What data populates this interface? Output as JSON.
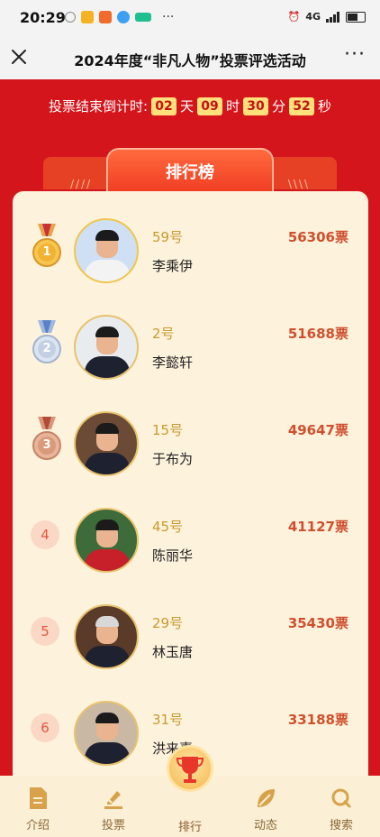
{
  "status_bar": {
    "time": "20:29",
    "network": "4G",
    "more": "···"
  },
  "nav": {
    "title": "2024年度“非凡人物”投票评选活动",
    "more": "···"
  },
  "countdown": {
    "label": "投票结束倒计时:",
    "days": "02",
    "days_unit": "天",
    "hours": "09",
    "hours_unit": "时",
    "minutes": "30",
    "minutes_unit": "分",
    "seconds": "52",
    "seconds_unit": "秒"
  },
  "ranking": {
    "header": "排行榜",
    "entries": [
      {
        "rank": "1",
        "number": "59号",
        "name": "李乘伊",
        "votes": "56306票",
        "medal": "gold"
      },
      {
        "rank": "2",
        "number": "2号",
        "name": "李懿轩",
        "votes": "51688票",
        "medal": "silver"
      },
      {
        "rank": "3",
        "number": "15号",
        "name": "于布为",
        "votes": "49647票",
        "medal": "bronze"
      },
      {
        "rank": "4",
        "number": "45号",
        "name": "陈丽华",
        "votes": "41127票"
      },
      {
        "rank": "5",
        "number": "29号",
        "name": "林玉唐",
        "votes": "35430票"
      },
      {
        "rank": "6",
        "number": "31号",
        "name": "洪来喜",
        "votes": "33188票"
      }
    ]
  },
  "tabbar": {
    "items": [
      {
        "label": "介绍",
        "icon": "document-icon"
      },
      {
        "label": "投票",
        "icon": "vote-icon"
      },
      {
        "label": "排行",
        "icon": "trophy-icon"
      },
      {
        "label": "动态",
        "icon": "leaf-icon"
      },
      {
        "label": "搜索",
        "icon": "search-icon"
      }
    ]
  },
  "colors": {
    "primary": "#d4161c",
    "card": "#fdf2dc",
    "gold": "#c99a2e",
    "votes": "#d0502e"
  }
}
